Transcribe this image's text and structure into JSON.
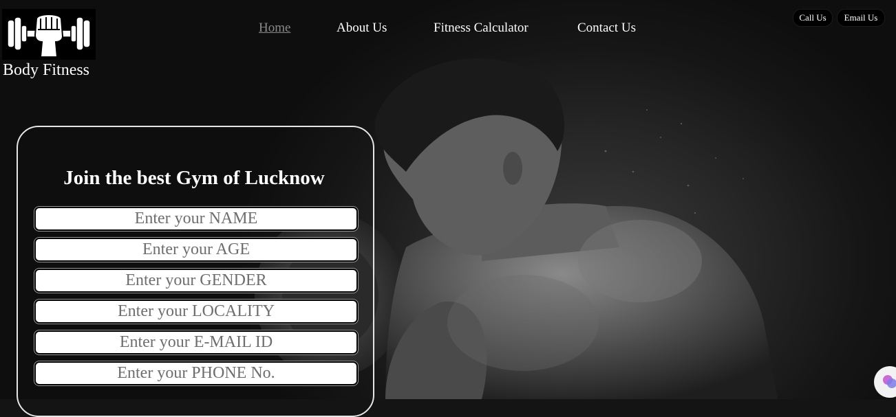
{
  "brand": {
    "name": "Body Fitness",
    "logo_icon": "fist-dumbbell-logo"
  },
  "nav": {
    "items": [
      {
        "label": "Home",
        "active": true
      },
      {
        "label": "About Us",
        "active": false
      },
      {
        "label": "Fitness Calculator",
        "active": false
      },
      {
        "label": "Contact Us",
        "active": false
      }
    ]
  },
  "contact_buttons": {
    "call": "Call Us",
    "email": "Email Us"
  },
  "signup": {
    "title": "Join the best Gym of Lucknow",
    "fields": [
      {
        "placeholder": "Enter your NAME"
      },
      {
        "placeholder": "Enter your AGE"
      },
      {
        "placeholder": "Enter your GENDER"
      },
      {
        "placeholder": "Enter your LOCALITY"
      },
      {
        "placeholder": "Enter your E-MAIL ID"
      },
      {
        "placeholder": "Enter your PHONE No."
      }
    ]
  },
  "hero": {
    "image_icon": "bodybuilder-photo"
  },
  "widget": {
    "icon": "assistant-widget-icon"
  },
  "colors": {
    "background": "#141414",
    "text": "#ffffff",
    "nav_active": "#8a8a8a",
    "pill_bg": "#000000",
    "field_bg": "#ffffff"
  }
}
